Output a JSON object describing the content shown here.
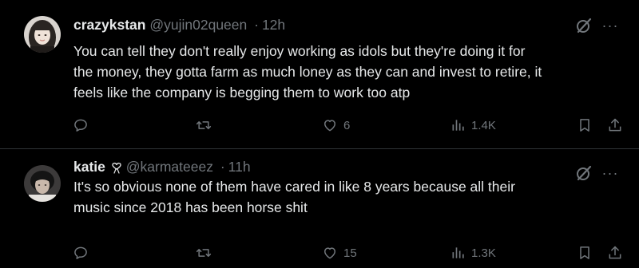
{
  "tweets": [
    {
      "display_name": "crazykstan",
      "handle": "@yujin02queen",
      "separator": "·",
      "time": "12h",
      "text_lines": [
        "You can tell they don't really enjoy working as idols but they're doing it for",
        "the money, they gotta farm as much loney as they can and invest to retire, it",
        "feels like the company is begging them to work too atp"
      ],
      "likes": "6",
      "views": "1.4K",
      "more_label": "···"
    },
    {
      "display_name": "katie",
      "handle": "@karmateeez",
      "separator": "·",
      "time": "11h",
      "text_lines": [
        "It's so obvious none of them have cared in like 8 years because all their",
        "music since 2018 has been horse shit"
      ],
      "likes": "15",
      "views": "1.3K",
      "more_label": "···"
    }
  ],
  "icons": {
    "reply": "reply-icon",
    "retweet": "retweet-icon",
    "like": "heart-icon",
    "views": "views-chart-icon",
    "bookmark": "bookmark-icon",
    "share": "share-icon",
    "grok": "grok-icon",
    "more": "more-icon",
    "name_badge": "heart-ribbon-icon"
  },
  "colors": {
    "background": "#000000",
    "text_primary": "#e7e9ea",
    "text_secondary": "#71767b",
    "divider": "#2f3336"
  }
}
